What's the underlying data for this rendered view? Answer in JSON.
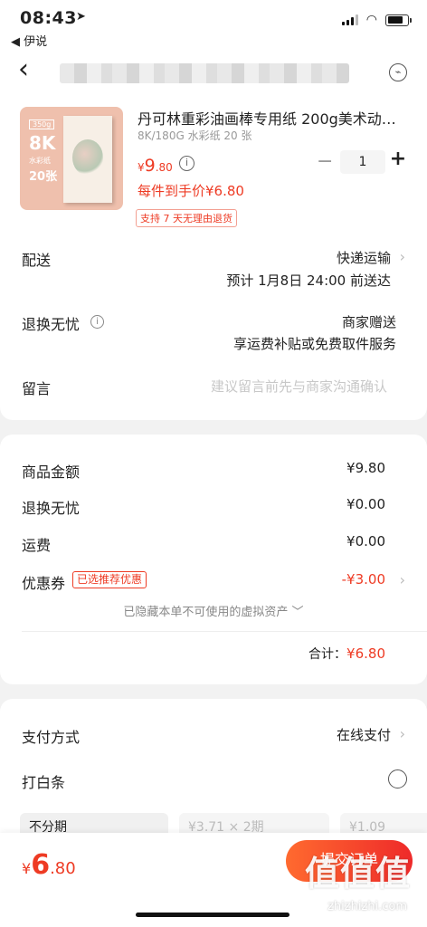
{
  "status_bar": {
    "time": "08:43",
    "back_app": "◀ 伊说"
  },
  "product": {
    "thumb_tag": "350g",
    "thumb_size": "8K",
    "thumb_sub": "水彩纸",
    "thumb_count": "20张",
    "title": "丹可林重彩油画棒专用纸 200g美术动…",
    "sku": "8K/180G 水彩纸 20 张",
    "price_currency": "¥",
    "price_int": "9",
    "price_dec": ".80",
    "quantity": "1",
    "final_price": "每件到手价¥6.80",
    "badge": "支持 7 天无理由退货"
  },
  "delivery": {
    "label": "配送",
    "method": "快递运输",
    "eta": "预计 1月8日 24:00 前送达"
  },
  "worry_free": {
    "label": "退换无忧",
    "value": "商家赠送",
    "desc": "享运费补贴或免费取件服务"
  },
  "message": {
    "label": "留言",
    "placeholder": "建议留言前先与商家沟通确认"
  },
  "summary": {
    "goods_label": "商品金额",
    "goods_value": "¥9.80",
    "worry_label": "退换无忧",
    "worry_value": "¥0.00",
    "freight_label": "运费",
    "freight_value": "¥0.00",
    "coupon_label": "优惠券",
    "coupon_tag": "已选推荐优惠",
    "coupon_value": "-¥3.00",
    "hidden_note": "已隐藏本单不可使用的虚拟资产 ﹀",
    "total_label": "合计：",
    "total_value": "¥6.80"
  },
  "payment": {
    "method_label": "支付方式",
    "method_value": "在线支付",
    "blank_note_label": "打白条",
    "installment_1": "不分期",
    "installment_2": "¥3.71 × 2期",
    "installment_3": "¥1.09"
  },
  "bottom": {
    "currency": "¥",
    "int": "6",
    "dec": ".80",
    "submit": "提交订单",
    "watermark": "值值值",
    "watermark_sub": "zhizhizhi.com"
  },
  "colors": {
    "accent": "#ee3b24",
    "button_start": "#ff6a2f",
    "button_end": "#ee2a2a"
  }
}
